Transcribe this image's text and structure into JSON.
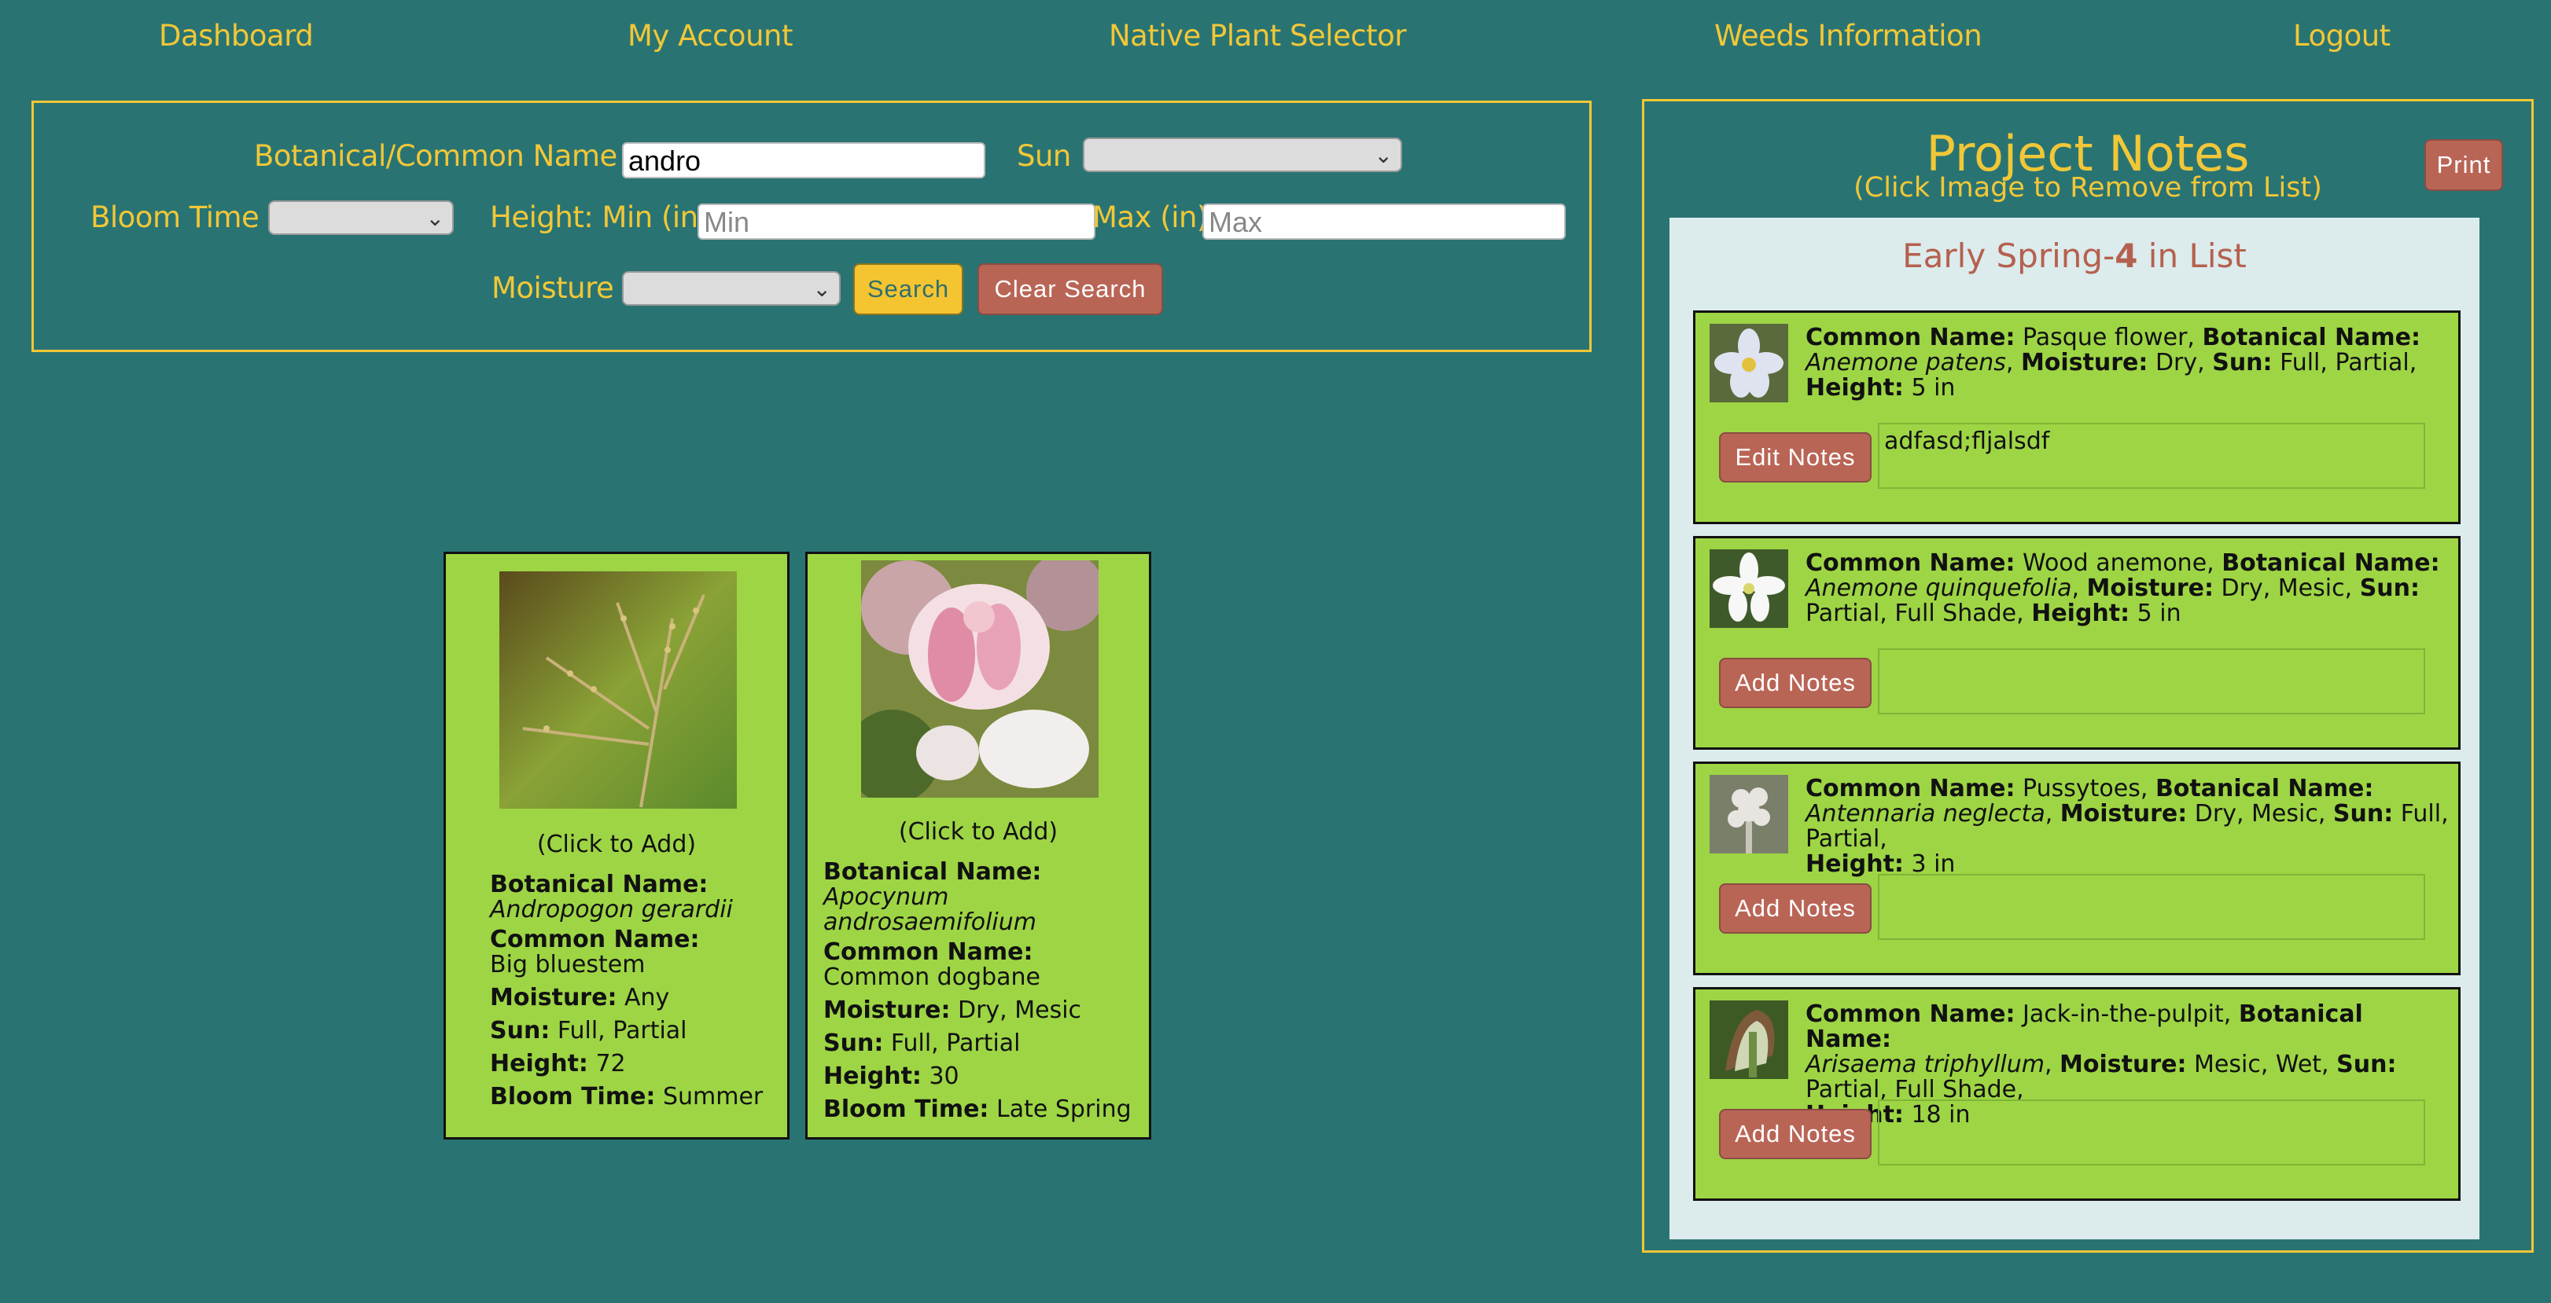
{
  "nav": {
    "dashboard": "Dashboard",
    "my_account": "My Account",
    "native_plant_selector": "Native Plant Selector",
    "weeds_information": "Weeds Information",
    "logout": "Logout"
  },
  "search": {
    "name_label": "Botanical/Common Name",
    "name_value": "andro",
    "sun_label": "Sun",
    "sun_value": "",
    "bloom_label": "Bloom Time",
    "bloom_value": "",
    "height_min_label": "Height: Min (in)",
    "height_min_placeholder": "Min",
    "height_max_label": "Max (in)",
    "height_max_placeholder": "Max",
    "moisture_label": "Moisture",
    "moisture_value": "",
    "search_button": "Search",
    "clear_button": "Clear Search"
  },
  "results": [
    {
      "click_text": "(Click to Add)",
      "botanical_label": "Botanical Name:",
      "botanical_name": "Andropogon gerardii",
      "common_label": "Common Name:",
      "common_name": "Big bluestem",
      "moisture_label": "Moisture:",
      "moisture": " Any",
      "sun_label": "Sun:",
      "sun": " Full, Partial",
      "height_label": "Height:",
      "height": " 72",
      "bloom_label": "Bloom Time:",
      "bloom": " Summer"
    },
    {
      "click_text": "(Click to Add)",
      "botanical_label": "Botanical Name:",
      "botanical_name_line1": "Apocynum",
      "botanical_name_line2": "androsaemifolium",
      "common_label": "Common Name:",
      "common_name": "Common dogbane",
      "moisture_label": "Moisture:",
      "moisture": " Dry, Mesic",
      "sun_label": "Sun:",
      "sun": " Full, Partial",
      "height_label": "Height:",
      "height": " 30",
      "bloom_label": "Bloom Time:",
      "bloom": " Late Spring"
    }
  ],
  "notes": {
    "title": "Project Notes",
    "subtitle": "(Click Image to Remove from List)",
    "print_button": "Print",
    "list_title_prefix": "Early Spring-",
    "list_count": "4",
    "list_title_suffix": " in List",
    "items": [
      {
        "common_label": "Common Name:",
        "common_name": " Pasque flower,",
        "botanical_label": "Botanical Name:",
        "botanical_name": "Anemone patens",
        "moisture_label": "Moisture:",
        "moisture": " Dry,",
        "sun_label": "Sun:",
        "sun": " Full, Partial,",
        "height_label": "Height:",
        "height": " 5 in",
        "button": "Edit Notes",
        "note": "adfasd;fljalsdf"
      },
      {
        "common_label": "Common Name:",
        "common_name": " Wood anemone,",
        "botanical_label": "Botanical Name:",
        "botanical_name": "Anemone quinquefolia",
        "moisture_label": "Moisture:",
        "moisture": " Dry, Mesic,",
        "sun_label": "Sun:",
        "sun": " Partial, Full Shade,",
        "height_label": "Height:",
        "height": " 5 in",
        "button": "Add Notes",
        "note": ""
      },
      {
        "common_label": "Common Name:",
        "common_name": " Pussytoes,",
        "botanical_label": "Botanical Name:",
        "botanical_name": "Antennaria neglecta",
        "moisture_label": "Moisture:",
        "moisture": " Dry, Mesic,",
        "sun_label": "Sun:",
        "sun": " Full, Partial,",
        "height_label": "Height:",
        "height": " 3 in",
        "button": "Add Notes",
        "note": ""
      },
      {
        "common_label": "Common Name:",
        "common_name": " Jack-in-the-pulpit,",
        "botanical_label": "Botanical Name:",
        "botanical_name": "Arisaema triphyllum",
        "moisture_label": "Moisture:",
        "moisture": " Mesic, Wet,",
        "sun_label": "Sun:",
        "sun": " Partial, Full Shade,",
        "height_label": "Height:",
        "height": " 18 in",
        "button": "Add Notes",
        "note": ""
      }
    ]
  },
  "colors": {
    "background": "#297473",
    "accent_yellow": "#f2c737",
    "card_green": "#9ed545",
    "button_red": "#b96556",
    "list_bg": "#dcebec"
  }
}
